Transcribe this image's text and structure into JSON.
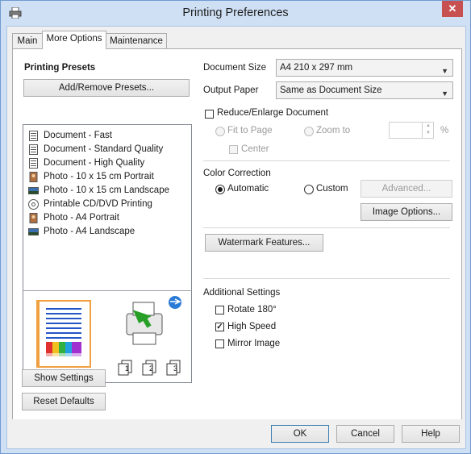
{
  "window": {
    "title": "Printing Preferences",
    "close_glyph": "✕",
    "app_icon": "printer-icon"
  },
  "tabs": [
    {
      "label": "Main",
      "active": false
    },
    {
      "label": "More Options",
      "active": true
    },
    {
      "label": "Maintenance",
      "active": false
    }
  ],
  "presets": {
    "heading": "Printing Presets",
    "add_remove_label": "Add/Remove Presets...",
    "items": [
      {
        "label": "Document - Fast",
        "icon": "document-icon"
      },
      {
        "label": "Document - Standard Quality",
        "icon": "document-icon"
      },
      {
        "label": "Document - High Quality",
        "icon": "document-icon"
      },
      {
        "label": "Photo - 10 x 15 cm Portrait",
        "icon": "photo-portrait-icon"
      },
      {
        "label": "Photo - 10 x 15 cm Landscape",
        "icon": "photo-landscape-icon"
      },
      {
        "label": "Printable CD/DVD Printing",
        "icon": "cd-icon"
      },
      {
        "label": "Photo - A4 Portrait",
        "icon": "photo-portrait-icon"
      },
      {
        "label": "Photo - A4 Landscape",
        "icon": "photo-landscape-icon"
      }
    ],
    "show_settings_label": "Show Settings",
    "reset_defaults_label": "Reset Defaults"
  },
  "preview": {
    "copy_icons": [
      "1",
      "2",
      "3"
    ],
    "colors": {
      "paper_border": "#f0a040",
      "lines": "#2456c8"
    }
  },
  "document_size": {
    "label": "Document Size",
    "value": "A4 210 x 297 mm"
  },
  "output_paper": {
    "label": "Output Paper",
    "value": "Same as Document Size"
  },
  "reduce_enlarge": {
    "label": "Reduce/Enlarge Document",
    "checked": false,
    "fit_to_page": "Fit to Page",
    "zoom_to": "Zoom to",
    "percent": "%",
    "center": "Center"
  },
  "color_correction": {
    "heading": "Color Correction",
    "automatic": "Automatic",
    "custom": "Custom",
    "selected": "Automatic",
    "advanced_label": "Advanced...",
    "image_options_label": "Image Options..."
  },
  "watermark_label": "Watermark Features...",
  "additional_settings": {
    "heading": "Additional Settings",
    "rotate": {
      "label": "Rotate 180°",
      "checked": false
    },
    "high_speed": {
      "label": "High Speed",
      "checked": true
    },
    "mirror": {
      "label": "Mirror Image",
      "checked": false
    }
  },
  "footer": {
    "ok": "OK",
    "cancel": "Cancel",
    "help": "Help"
  },
  "checkmark": "✓",
  "spin_up": "▲",
  "spin_down": "▼",
  "combo_arrow": "▼"
}
